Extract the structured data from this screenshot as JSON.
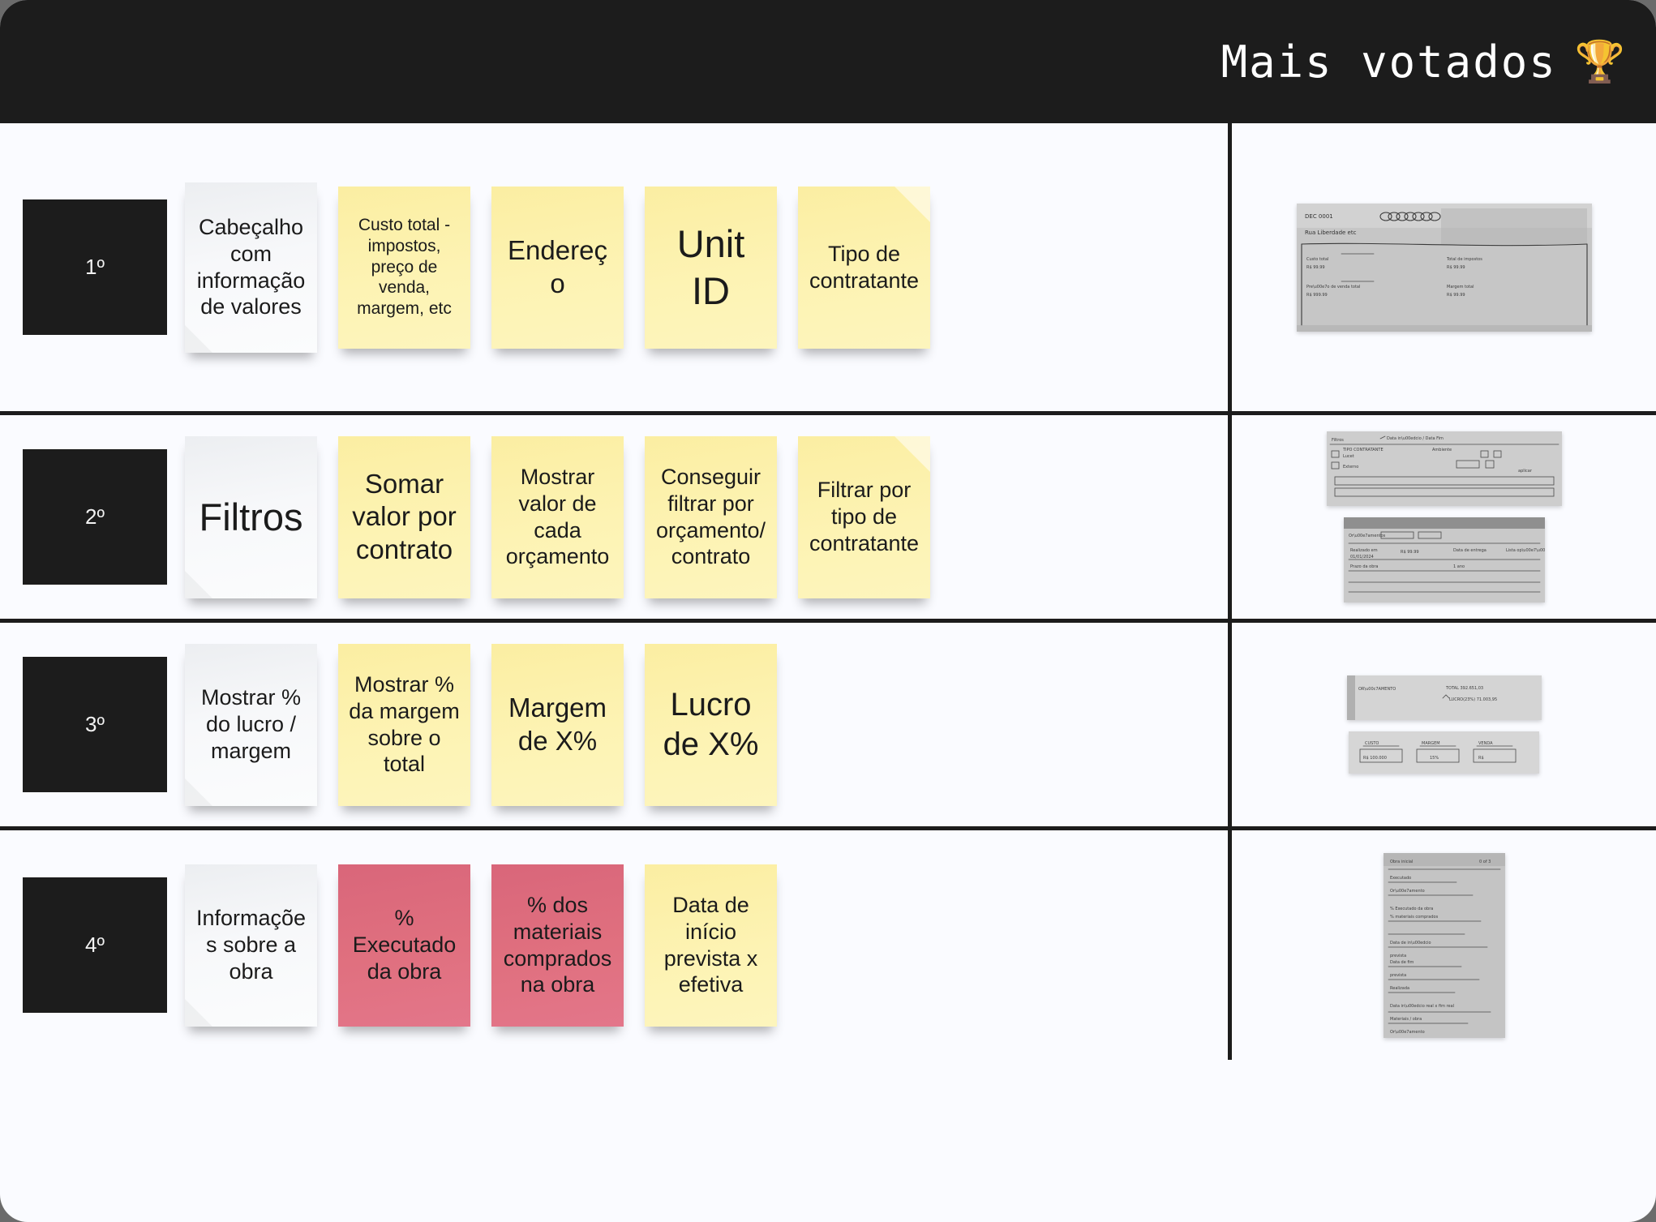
{
  "header": {
    "title": "Mais votados",
    "trophy_icon": "trophy-icon",
    "trophy_glyph": "🏆",
    "background_color": "#1c1c1c",
    "text_color": "#ffffff"
  },
  "colors": {
    "board_background": "#fafbff",
    "divider": "#1c1c1c",
    "note_white": "#f4f5f7",
    "note_yellow": "#fcf0a8",
    "note_pink": "#dd6b7f",
    "rank_badge_background": "#1c1c1c",
    "rank_badge_text": "#f2f2f2"
  },
  "rows": [
    {
      "rank": "1º",
      "notes": [
        {
          "text": "Cabeçalho com informação de valores",
          "color": "white",
          "size": "md"
        },
        {
          "text": "Custo total - impostos, preço  de venda, margem, etc",
          "color": "yellow",
          "size": "sm"
        },
        {
          "text": "Endereço",
          "color": "yellow",
          "size": "lg"
        },
        {
          "text": "Unit ID",
          "color": "yellow",
          "size": "xxl"
        },
        {
          "text": "Tipo de contratante",
          "color": "yellow",
          "size": "md"
        }
      ],
      "photos": [
        {
          "name": "sketch-photo-header-values",
          "caption_lines": [
            "DEC 0001",
            "Rua Liberdade etc",
            "Custo total",
            "R$ 99.99",
            "Total de impostos",
            "R$ 99.99",
            "Preço de venda total",
            "Margem total"
          ]
        }
      ]
    },
    {
      "rank": "2º",
      "notes": [
        {
          "text": "Filtros",
          "color": "white",
          "size": "xxl"
        },
        {
          "text": "Somar valor por contrato",
          "color": "yellow",
          "size": "lg"
        },
        {
          "text": "Mostrar valor de cada orçamento",
          "color": "yellow",
          "size": "md"
        },
        {
          "text": "Conseguir filtrar por orçamento/ contrato",
          "color": "yellow",
          "size": "md"
        },
        {
          "text": "Filtrar por tipo de contratante",
          "color": "yellow",
          "size": "md"
        }
      ],
      "photos": [
        {
          "name": "sketch-photo-filters-top",
          "caption_lines": [
            "Filtros",
            "Data início / Data Fim",
            "TIPO CONTRATANTE",
            "Ambiente",
            "Lucet",
            "Externo",
            "aplicar"
          ]
        },
        {
          "name": "sketch-photo-filters-table",
          "caption_lines": [
            "Orçamentos",
            "Realizado em",
            "Data de entrega",
            "Lista opções"
          ]
        }
      ]
    },
    {
      "rank": "3º",
      "notes": [
        {
          "text": "Mostrar % do lucro / margem",
          "color": "white",
          "size": "md"
        },
        {
          "text": "Mostrar % da margem sobre o total",
          "color": "yellow",
          "size": "md"
        },
        {
          "text": "Margem de X%",
          "color": "yellow",
          "size": "lg"
        },
        {
          "text": "Lucro de X%",
          "color": "yellow",
          "size": "xl"
        }
      ],
      "photos": [
        {
          "name": "sketch-photo-budget-total",
          "caption_lines": [
            "ORÇAMENTO",
            "TOTAL  392.651,03",
            "LUCRO(23%) 71.003,95"
          ]
        },
        {
          "name": "sketch-photo-cost-margin-sale",
          "caption_lines": [
            "CUSTO",
            "R$ 100.000",
            "MARGEM",
            "15%",
            "VENDA",
            "R$"
          ]
        }
      ]
    },
    {
      "rank": "4º",
      "notes": [
        {
          "text": "Informações sobre a obra",
          "color": "white",
          "size": "md"
        },
        {
          "text": "% Executado da obra",
          "color": "pink",
          "size": "md"
        },
        {
          "text": "% dos materiais comprados na obra",
          "color": "pink",
          "size": "md"
        },
        {
          "text": "Data de início prevista x efetiva",
          "color": "yellow",
          "size": "md"
        }
      ],
      "photos": [
        {
          "name": "sketch-photo-obra-notes",
          "caption_lines": [
            "Obra inicial",
            "Executado",
            "Orçamento",
            "Materiais comprados",
            "Data de início",
            "Data fim",
            "Prevista",
            "Realizada"
          ]
        }
      ]
    }
  ]
}
